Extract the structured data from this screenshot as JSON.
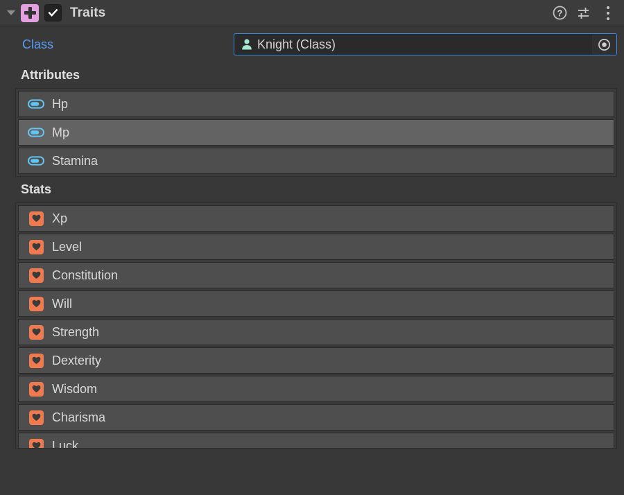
{
  "header": {
    "foldout_icon": "triangle-down-icon",
    "script_icon": "script-plus-icon",
    "enabled_checkbox_icon": "checkmark-icon",
    "enabled": true,
    "title": "Traits",
    "help_icon": "help-circle-icon",
    "preset_icon": "preset-sliders-icon",
    "menu_icon": "kebab-menu-icon",
    "colors": {
      "script_icon_bg": "#e3a1e0",
      "header_bg": "#3c3c3c"
    }
  },
  "class_field": {
    "label": "Class",
    "value": "Knight (Class)",
    "value_icon": "person-scriptableobject-icon",
    "picker_icon": "object-picker-target-icon",
    "focused": true,
    "accent_color": "#3b89e0",
    "label_color": "#5a9bf0",
    "value_icon_color": "#a6e8d0"
  },
  "attributes": {
    "title": "Attributes",
    "row_icon": "toggle-pill-icon",
    "row_icon_color": "#62c4f2",
    "items": [
      {
        "label": "Hp",
        "selected": false
      },
      {
        "label": "Mp",
        "selected": true
      },
      {
        "label": "Stamina",
        "selected": false
      }
    ]
  },
  "stats": {
    "title": "Stats",
    "row_icon": "heart-badge-icon",
    "row_icon_color": "#ef7a4f",
    "items": [
      {
        "label": "Xp",
        "selected": false
      },
      {
        "label": "Level",
        "selected": false
      },
      {
        "label": "Constitution",
        "selected": false
      },
      {
        "label": "Will",
        "selected": false
      },
      {
        "label": "Strength",
        "selected": false
      },
      {
        "label": "Dexterity",
        "selected": false
      },
      {
        "label": "Wisdom",
        "selected": false
      },
      {
        "label": "Charisma",
        "selected": false
      },
      {
        "label": "Luck",
        "selected": false
      }
    ]
  }
}
